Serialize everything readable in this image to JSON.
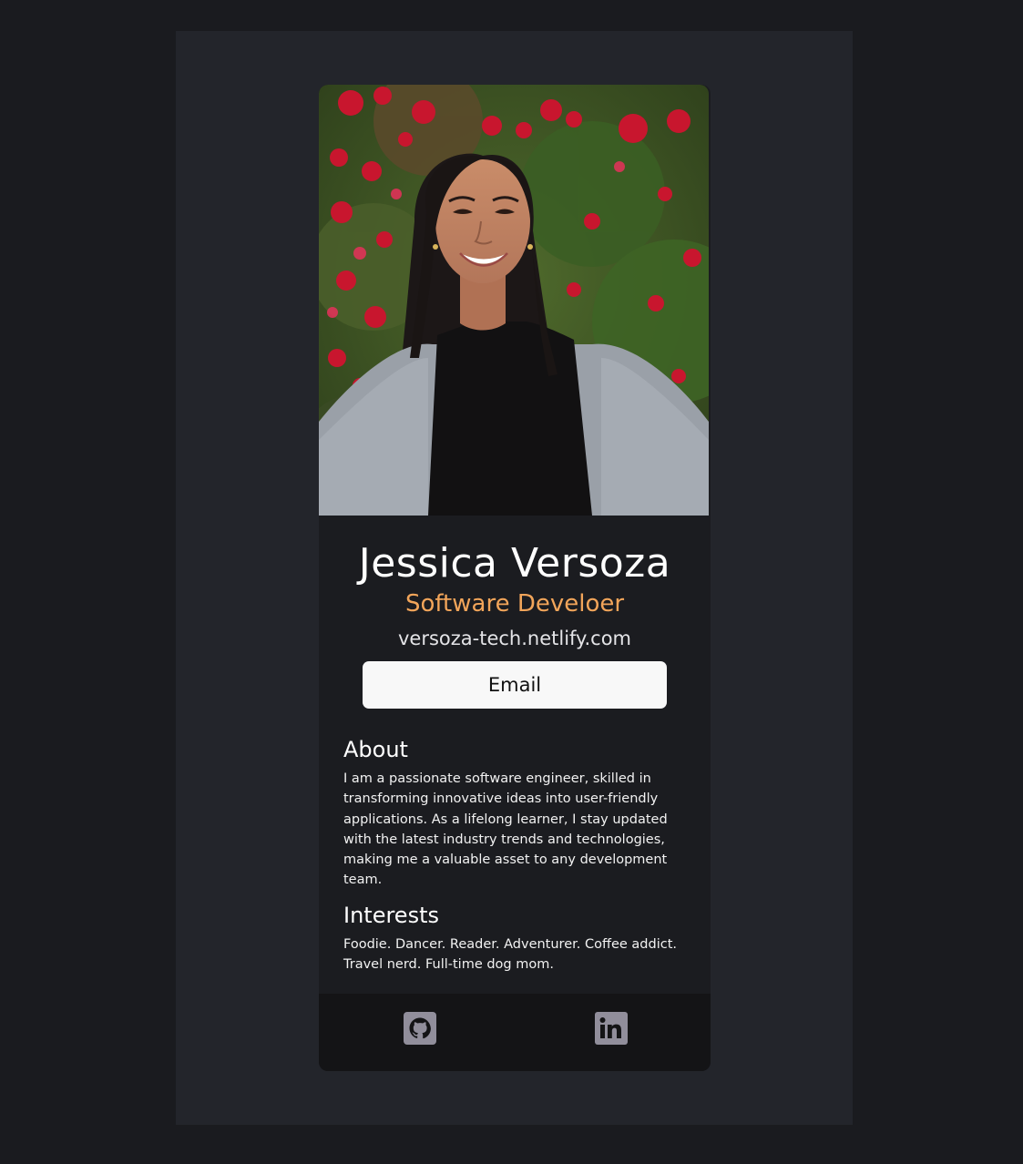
{
  "profile": {
    "name": "Jessica Versoza",
    "title": "Software Develoer",
    "website": "versoza-tech.netlify.com",
    "email_button": "Email"
  },
  "about": {
    "heading": "About",
    "text": "I am a passionate software engineer, skilled in transforming innovative ideas into user-friendly applications. As a lifelong learner, I stay updated with the latest industry trends and technologies, making me a valuable asset to any development team."
  },
  "interests": {
    "heading": "Interests",
    "text": "Foodie. Dancer. Reader. Adventurer. Coffee addict. Travel nerd. Full-time dog mom."
  },
  "social": {
    "icons": [
      "github-icon",
      "linkedin-icon"
    ]
  },
  "colors": {
    "page_background": "#1a1b1f",
    "frame_background": "#23252b",
    "card_background": "#1b1c20",
    "footer_background": "#141416",
    "accent": "#f2a55a",
    "icon_gray": "#918e9b"
  }
}
